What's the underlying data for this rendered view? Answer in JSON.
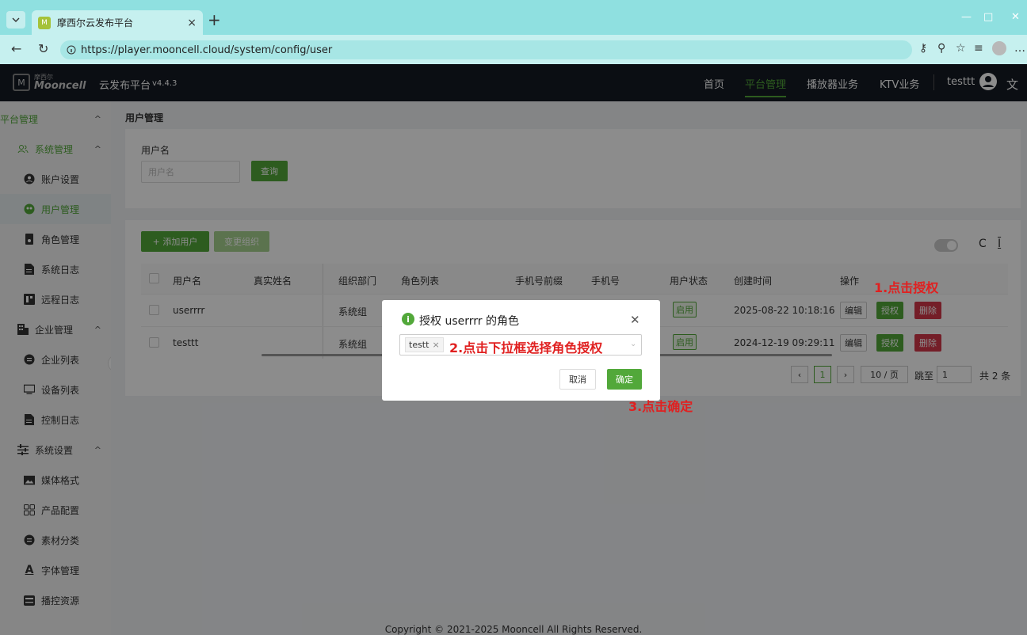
{
  "browser": {
    "tab_title": "摩西尔云发布平台",
    "tab_close": "×",
    "new_tab": "+",
    "url": "https://player.mooncell.cloud/system/config/user",
    "win_min": "—",
    "win_max": "□",
    "win_close": "✕"
  },
  "header": {
    "logo_small": "摩西尔",
    "logo_text": "Mooncell",
    "app_title": "云发布平台",
    "version": "v4.4.3",
    "menu": [
      "首页",
      "平台管理",
      "播放器业务",
      "KTV业务"
    ],
    "active_menu": "平台管理",
    "username": "testtt"
  },
  "sidebar": {
    "top_group": "平台管理",
    "items": [
      {
        "label": "系统管理",
        "icon": "users-icon"
      },
      {
        "label": "账户设置",
        "icon": "user-circle-icon"
      },
      {
        "label": "用户管理",
        "icon": "user-group-icon"
      },
      {
        "label": "角色管理",
        "icon": "role-icon"
      },
      {
        "label": "系统日志",
        "icon": "file-icon"
      },
      {
        "label": "远程日志",
        "icon": "remote-log-icon"
      },
      {
        "label": "企业管理",
        "icon": "building-icon"
      },
      {
        "label": "企业列表",
        "icon": "list-circle-icon"
      },
      {
        "label": "设备列表",
        "icon": "monitor-icon"
      },
      {
        "label": "控制日志",
        "icon": "file-icon"
      },
      {
        "label": "系统设置",
        "icon": "sliders-icon"
      },
      {
        "label": "媒体格式",
        "icon": "image-icon"
      },
      {
        "label": "产品配置",
        "icon": "grid-icon"
      },
      {
        "label": "素材分类",
        "icon": "list-circle-icon"
      },
      {
        "label": "字体管理",
        "icon": "font-icon"
      },
      {
        "label": "播控资源",
        "icon": "server-icon"
      }
    ]
  },
  "page": {
    "breadcrumb": "用户管理",
    "search_label": "用户名",
    "search_placeholder": "用户名",
    "query_button": "查询",
    "add_button": "+ 添加用户",
    "change_org_button": "变更组织",
    "toolbar_refresh": "C",
    "toolbar_density": "I"
  },
  "table": {
    "headers": [
      "用户名",
      "真实姓名",
      "组织部门",
      "角色列表",
      "手机号前缀",
      "手机号",
      "用户状态",
      "创建时间",
      "操作"
    ],
    "rows": [
      {
        "username": "userrrr",
        "realname": "",
        "dept": "系统组",
        "status": "启用",
        "created": "2025-08-22 10:18:16"
      },
      {
        "username": "testtt",
        "realname": "",
        "dept": "系统组",
        "status": "启用",
        "created": "2024-12-19 09:29:11"
      }
    ],
    "action_edit": "编辑",
    "action_auth": "授权",
    "action_delete": "删除"
  },
  "pagination": {
    "current": "1",
    "page_size": "10 / 页",
    "jump_label": "跳至",
    "jump_value": "1",
    "total": "共 2 条"
  },
  "modal": {
    "title": "授权 userrrr 的角色",
    "selected_tag": "testt",
    "cancel": "取消",
    "confirm": "确定"
  },
  "annotations": {
    "step1": "1.点击授权",
    "step2": "2.点击下拉框选择角色授权",
    "step3": "3.点击确定"
  },
  "footer": {
    "copyright": "Copyright © 2021-2025 Mooncell All Rights Reserved."
  },
  "colors": {
    "accent": "#52a83a",
    "danger": "#d4374a",
    "annotation": "#e02020",
    "header_bg": "#141a24"
  }
}
